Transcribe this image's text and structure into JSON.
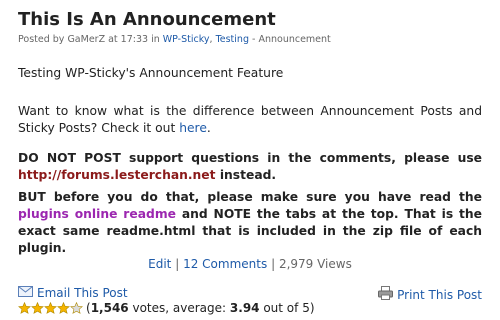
{
  "post": {
    "title": "This Is An Announcement",
    "meta": {
      "prefix": "Posted by GaMerZ at 17:33 in",
      "cat1": "WP-Sticky",
      "sep1": ",",
      "cat2": "Testing",
      "suffix": "- Announcement"
    },
    "p1": "Testing WP-Sticky's Announcement Feature",
    "p2": {
      "text": "Want to know what is the difference between Announcement Posts and Sticky Posts? Check it out",
      "link": "here",
      "end": "."
    },
    "p3": {
      "text": "DO NOT POST support questions in the comments, please use",
      "link": "http://forums.lesterchan.net",
      "end": "instead."
    },
    "p4": {
      "text1": "BUT before you do that, please make sure you have read the",
      "link": "plugins online readme",
      "text2": "and NOTE the tabs at the top. That is the exact same readme.html that is included in the zip file of each plugin."
    },
    "links": {
      "edit": "Edit",
      "sep1": "|",
      "comments": "12 Comments",
      "sep2": "|",
      "views": "2,979 Views"
    },
    "email_label": "Email This Post",
    "print_label": "Print This Post",
    "rating": {
      "open": "(",
      "votes": "1,546",
      "votes_label": "votes, average:",
      "average": "3.94",
      "outof": "out of 5)",
      "value": 3.94,
      "max": 5
    }
  },
  "colors": {
    "link": "#1e5aa8",
    "url_link": "#8b1a1a",
    "readme_link": "#9c27b0",
    "star": "#f5b400"
  }
}
